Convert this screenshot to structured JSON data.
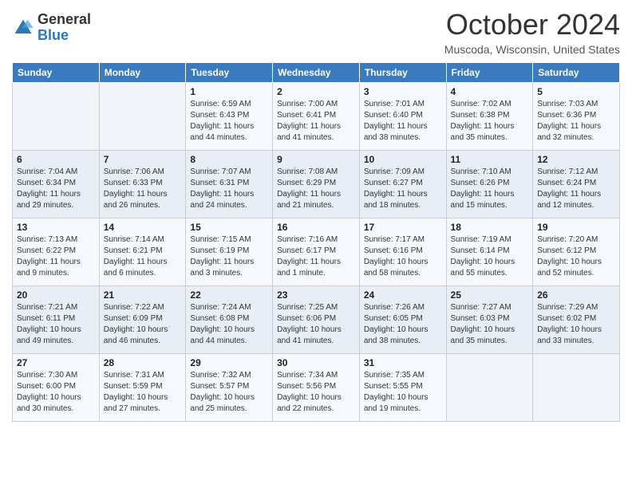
{
  "header": {
    "logo_general": "General",
    "logo_blue": "Blue",
    "title": "October 2024",
    "location": "Muscoda, Wisconsin, United States"
  },
  "days_of_week": [
    "Sunday",
    "Monday",
    "Tuesday",
    "Wednesday",
    "Thursday",
    "Friday",
    "Saturday"
  ],
  "weeks": [
    [
      {
        "day": "",
        "info": ""
      },
      {
        "day": "",
        "info": ""
      },
      {
        "day": "1",
        "info": "Sunrise: 6:59 AM\nSunset: 6:43 PM\nDaylight: 11 hours and 44 minutes."
      },
      {
        "day": "2",
        "info": "Sunrise: 7:00 AM\nSunset: 6:41 PM\nDaylight: 11 hours and 41 minutes."
      },
      {
        "day": "3",
        "info": "Sunrise: 7:01 AM\nSunset: 6:40 PM\nDaylight: 11 hours and 38 minutes."
      },
      {
        "day": "4",
        "info": "Sunrise: 7:02 AM\nSunset: 6:38 PM\nDaylight: 11 hours and 35 minutes."
      },
      {
        "day": "5",
        "info": "Sunrise: 7:03 AM\nSunset: 6:36 PM\nDaylight: 11 hours and 32 minutes."
      }
    ],
    [
      {
        "day": "6",
        "info": "Sunrise: 7:04 AM\nSunset: 6:34 PM\nDaylight: 11 hours and 29 minutes."
      },
      {
        "day": "7",
        "info": "Sunrise: 7:06 AM\nSunset: 6:33 PM\nDaylight: 11 hours and 26 minutes."
      },
      {
        "day": "8",
        "info": "Sunrise: 7:07 AM\nSunset: 6:31 PM\nDaylight: 11 hours and 24 minutes."
      },
      {
        "day": "9",
        "info": "Sunrise: 7:08 AM\nSunset: 6:29 PM\nDaylight: 11 hours and 21 minutes."
      },
      {
        "day": "10",
        "info": "Sunrise: 7:09 AM\nSunset: 6:27 PM\nDaylight: 11 hours and 18 minutes."
      },
      {
        "day": "11",
        "info": "Sunrise: 7:10 AM\nSunset: 6:26 PM\nDaylight: 11 hours and 15 minutes."
      },
      {
        "day": "12",
        "info": "Sunrise: 7:12 AM\nSunset: 6:24 PM\nDaylight: 11 hours and 12 minutes."
      }
    ],
    [
      {
        "day": "13",
        "info": "Sunrise: 7:13 AM\nSunset: 6:22 PM\nDaylight: 11 hours and 9 minutes."
      },
      {
        "day": "14",
        "info": "Sunrise: 7:14 AM\nSunset: 6:21 PM\nDaylight: 11 hours and 6 minutes."
      },
      {
        "day": "15",
        "info": "Sunrise: 7:15 AM\nSunset: 6:19 PM\nDaylight: 11 hours and 3 minutes."
      },
      {
        "day": "16",
        "info": "Sunrise: 7:16 AM\nSunset: 6:17 PM\nDaylight: 11 hours and 1 minute."
      },
      {
        "day": "17",
        "info": "Sunrise: 7:17 AM\nSunset: 6:16 PM\nDaylight: 10 hours and 58 minutes."
      },
      {
        "day": "18",
        "info": "Sunrise: 7:19 AM\nSunset: 6:14 PM\nDaylight: 10 hours and 55 minutes."
      },
      {
        "day": "19",
        "info": "Sunrise: 7:20 AM\nSunset: 6:12 PM\nDaylight: 10 hours and 52 minutes."
      }
    ],
    [
      {
        "day": "20",
        "info": "Sunrise: 7:21 AM\nSunset: 6:11 PM\nDaylight: 10 hours and 49 minutes."
      },
      {
        "day": "21",
        "info": "Sunrise: 7:22 AM\nSunset: 6:09 PM\nDaylight: 10 hours and 46 minutes."
      },
      {
        "day": "22",
        "info": "Sunrise: 7:24 AM\nSunset: 6:08 PM\nDaylight: 10 hours and 44 minutes."
      },
      {
        "day": "23",
        "info": "Sunrise: 7:25 AM\nSunset: 6:06 PM\nDaylight: 10 hours and 41 minutes."
      },
      {
        "day": "24",
        "info": "Sunrise: 7:26 AM\nSunset: 6:05 PM\nDaylight: 10 hours and 38 minutes."
      },
      {
        "day": "25",
        "info": "Sunrise: 7:27 AM\nSunset: 6:03 PM\nDaylight: 10 hours and 35 minutes."
      },
      {
        "day": "26",
        "info": "Sunrise: 7:29 AM\nSunset: 6:02 PM\nDaylight: 10 hours and 33 minutes."
      }
    ],
    [
      {
        "day": "27",
        "info": "Sunrise: 7:30 AM\nSunset: 6:00 PM\nDaylight: 10 hours and 30 minutes."
      },
      {
        "day": "28",
        "info": "Sunrise: 7:31 AM\nSunset: 5:59 PM\nDaylight: 10 hours and 27 minutes."
      },
      {
        "day": "29",
        "info": "Sunrise: 7:32 AM\nSunset: 5:57 PM\nDaylight: 10 hours and 25 minutes."
      },
      {
        "day": "30",
        "info": "Sunrise: 7:34 AM\nSunset: 5:56 PM\nDaylight: 10 hours and 22 minutes."
      },
      {
        "day": "31",
        "info": "Sunrise: 7:35 AM\nSunset: 5:55 PM\nDaylight: 10 hours and 19 minutes."
      },
      {
        "day": "",
        "info": ""
      },
      {
        "day": "",
        "info": ""
      }
    ]
  ]
}
